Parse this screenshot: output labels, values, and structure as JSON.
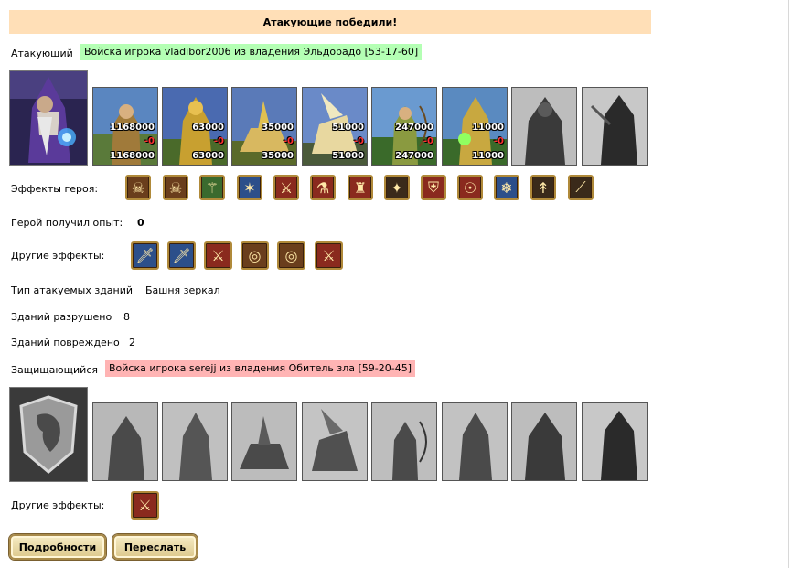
{
  "banner": {
    "text": "Атакующие победили!"
  },
  "attacker": {
    "label": "Атакующий",
    "army_tag": "Войска игрока vladibor2006 из владения Эльдорадо [53-17-60]",
    "units": [
      {
        "name": "unit-1",
        "before": "1168000",
        "after": "1168000",
        "loss": "-0"
      },
      {
        "name": "unit-2",
        "before": "63000",
        "after": "63000",
        "loss": "-0"
      },
      {
        "name": "unit-3",
        "before": "35000",
        "after": "35000",
        "loss": "-0"
      },
      {
        "name": "unit-4",
        "before": "51000",
        "after": "51000",
        "loss": "-0"
      },
      {
        "name": "unit-5",
        "before": "247000",
        "after": "247000",
        "loss": "-0"
      },
      {
        "name": "unit-6",
        "before": "11000",
        "after": "11000",
        "loss": "-0"
      }
    ]
  },
  "hero_effects_label": "Эффекты героя:",
  "hero_exp": {
    "label": "Герой получил опыт:",
    "value": "0"
  },
  "other_effects_label": "Другие эффекты:",
  "buildings": {
    "type_label": "Тип атакуемых зданий",
    "type_value": "Башня зеркал",
    "destroyed_label": "Зданий разрушено",
    "destroyed_value": "8",
    "damaged_label": "Зданий повреждено",
    "damaged_value": "2"
  },
  "defender": {
    "label": "Защищающийся",
    "army_tag": "Войска игрока serejj из владения Обитель зла [59-20-45]"
  },
  "defender_other_effects_label": "Другие эффекты:",
  "buttons": {
    "details": "Подробности",
    "forward": "Переслать"
  },
  "colors": {
    "banner_bg": "#ffdfb7",
    "attacker_tag_bg": "#b4ffb4",
    "defender_tag_bg": "#ffb4b4"
  }
}
